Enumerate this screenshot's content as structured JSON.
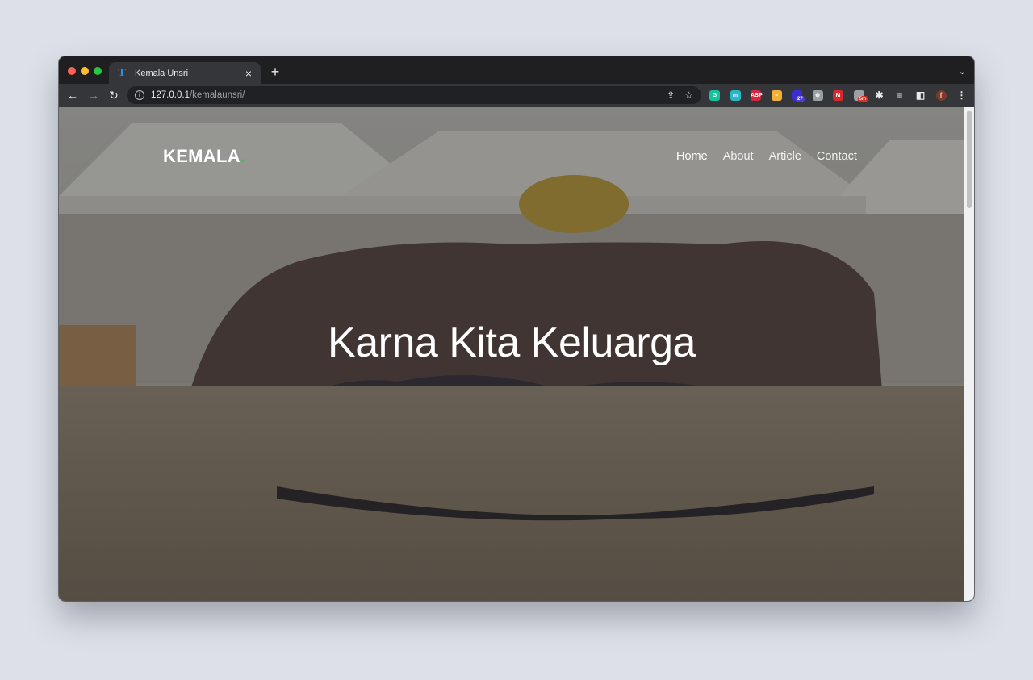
{
  "browser": {
    "tab_title": "Kemala Unsri",
    "tab_favicon": "T",
    "tab_close": "×",
    "new_tab": "+",
    "tab_menu": "⌄",
    "url_host": "127.0.0.1",
    "url_path": "/kemalaunsri/",
    "extensions": [
      {
        "name": "grammarly-extension-icon",
        "color": "#15c39a",
        "label": "G"
      },
      {
        "name": "mendeley-extension-icon",
        "color": "#2ab7c7",
        "label": "m"
      },
      {
        "name": "adblock-plus-extension-icon",
        "color": "#d7263d",
        "label": "ABP"
      },
      {
        "name": "notes-extension-icon",
        "color": "#f2b134",
        "label": "≡"
      },
      {
        "name": "profile-extension-icon",
        "color": "#3a2ecf",
        "label": "",
        "badge": "27",
        "badge_color": "#4b3ccf"
      },
      {
        "name": "globe-extension-icon",
        "color": "#9aa0a6",
        "label": "⊕"
      },
      {
        "name": "mega-extension-icon",
        "color": "#d9272e",
        "label": "M"
      },
      {
        "name": "timer-extension-icon",
        "color": "#9aa0a6",
        "label": "",
        "badge": "5m",
        "badge_color": "#d93025"
      },
      {
        "name": "puzzle-extensions-icon",
        "color": "transparent",
        "label": "✱"
      },
      {
        "name": "reading-list-icon",
        "color": "transparent",
        "label": "≡"
      },
      {
        "name": "side-panel-icon",
        "color": "transparent",
        "label": "◧"
      },
      {
        "name": "profile-avatar-icon",
        "color": "#7b3b2a",
        "label": "f"
      },
      {
        "name": "browser-menu-icon",
        "color": "transparent",
        "label": "⋮"
      }
    ]
  },
  "site": {
    "brand": "KEMALA",
    "brand_dot": ".",
    "nav": [
      {
        "label": "Home",
        "active": true
      },
      {
        "label": "About",
        "active": false
      },
      {
        "label": "Article",
        "active": false
      },
      {
        "label": "Contact",
        "active": false
      }
    ],
    "hero_title": "Karna Kita Keluarga"
  }
}
